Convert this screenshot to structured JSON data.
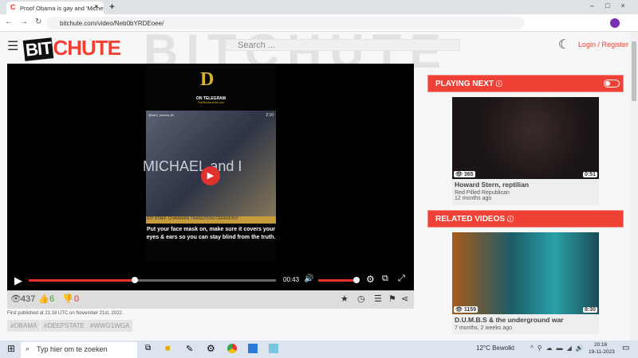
{
  "browser": {
    "tab_title": "Proof Obama is gay and 'Michel",
    "url": "bitchute.com/video/Neb0bYRDEoee/"
  },
  "header": {
    "logo_bit": "BIT",
    "logo_chute": "CHUTE",
    "search_placeholder": "Search ...",
    "login": "Login",
    "sep": " / ",
    "register": "Register",
    "bg_text": "BITCHUTE"
  },
  "video": {
    "overlay_brand": "D",
    "overlay_top": "ON TELEGRAM",
    "overlay_site": "TheStrickersHub.com",
    "handle": "@kark_ravasa_tik",
    "timer": "2:10",
    "overlay_words": "MICHAEL and I",
    "banner": "JCP STAFF CHAIRMAN TRANSITION CEREMONY",
    "caption": "Put your face mask on, make sure it covers your eyes & ears so you can stay blind from the truth.",
    "time": "00:43",
    "progress": 0.43,
    "volume": 1.0
  },
  "stats": {
    "views": "437",
    "likes": "6",
    "dislikes": "0"
  },
  "published": "First published at 21:18 UTC on November 21st, 2022.",
  "tags": [
    "#OBAMA",
    "#DEEPSTATE",
    "#WWG1WGA"
  ],
  "sidebar": {
    "playing_next": "PLAYING NEXT",
    "related": "RELATED VIDEOS",
    "next_video": {
      "views": "365",
      "duration": "0:51",
      "title": "Howard Stern, reptilian",
      "channel": "Red Pilled Republican",
      "age": "12 months ago"
    },
    "related_video": {
      "views": "1159",
      "duration": "8:30",
      "title": "D.U.M.B.S & the underground war",
      "age": "7 months, 2 weeks ago"
    }
  },
  "taskbar": {
    "search": "Typ hier om te zoeken",
    "weather": "12°C  Bewolkt",
    "time": "20:16",
    "date": "19-11-2023"
  },
  "colors": {
    "accent": "#ef4136"
  }
}
